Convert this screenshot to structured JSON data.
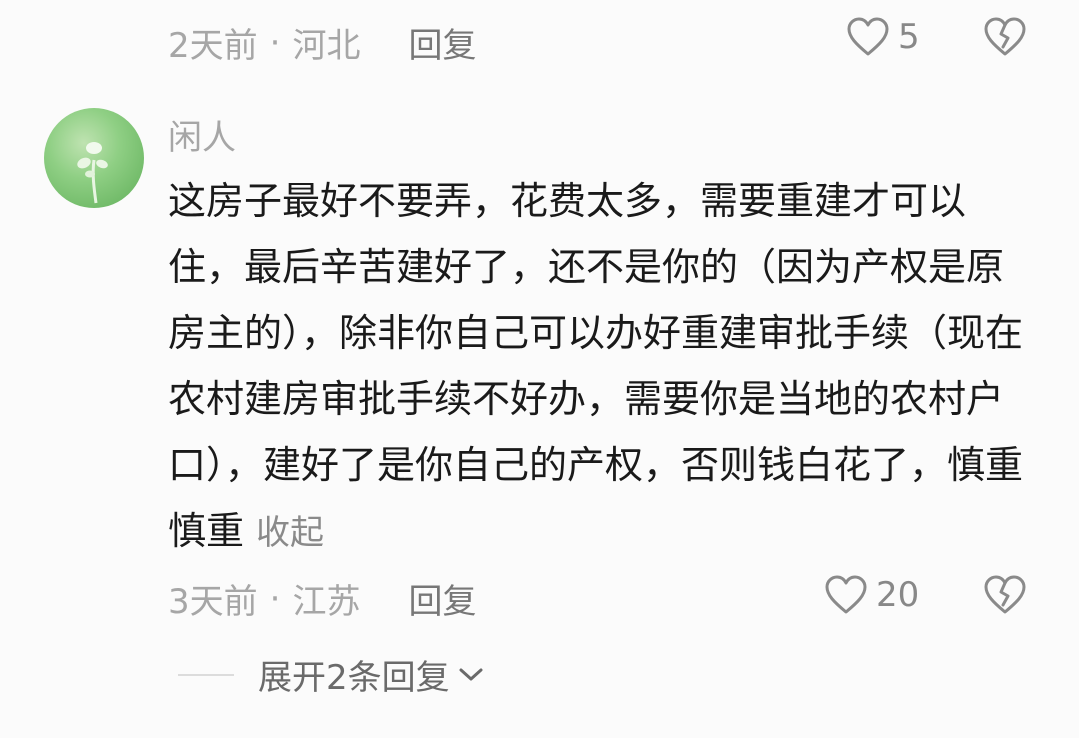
{
  "prev_comment": {
    "time": "2天前",
    "separator": "·",
    "location": "河北",
    "reply_label": "回复",
    "like_count": "5"
  },
  "comment": {
    "username": "闲人",
    "text": "这房子最好不要弄，花费太多，需要重建才可以住，最后辛苦建好了，还不是你的（因为产权是原房主的），除非你自己可以办好重建审批手续（现在农村建房审批手续不好办，需要你是当地的农村户口），建好了是你自己的产权，否则钱白花了，慎重慎重",
    "collapse_label": "收起",
    "time": "3天前",
    "separator": "·",
    "location": "江苏",
    "reply_label": "回复",
    "like_count": "20"
  },
  "expand_replies_label": "展开2条回复",
  "colors": {
    "secondary_text": "#a6a6a6",
    "primary_text": "#1a1a1a",
    "background": "#fbfbfb"
  },
  "icons": [
    "heart-outline-icon",
    "broken-heart-icon",
    "chevron-down-icon"
  ]
}
